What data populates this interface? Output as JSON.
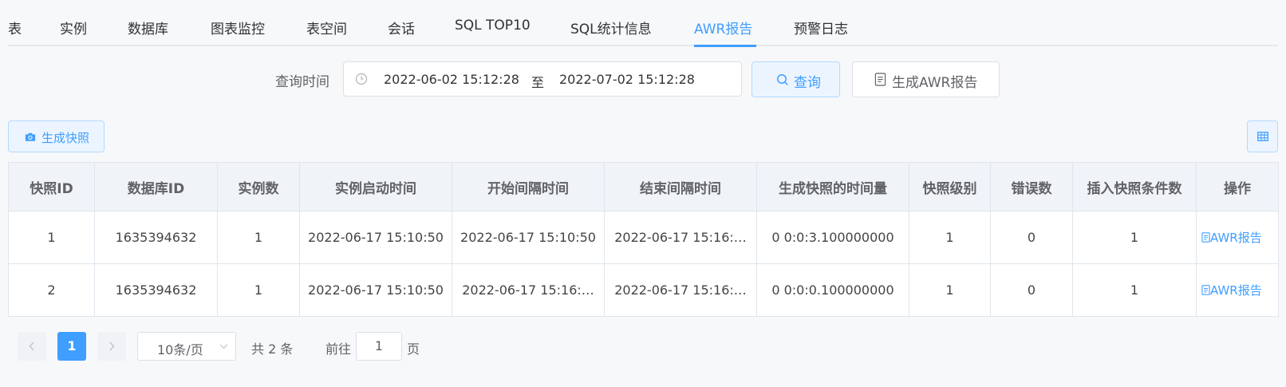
{
  "tabs": [
    {
      "label": "表"
    },
    {
      "label": "实例"
    },
    {
      "label": "数据库"
    },
    {
      "label": "图表监控"
    },
    {
      "label": "表空间"
    },
    {
      "label": "会话"
    },
    {
      "label": "SQL TOP10"
    },
    {
      "label": "SQL统计信息"
    },
    {
      "label": "AWR报告"
    },
    {
      "label": "预警日志"
    }
  ],
  "active_tab": "AWR报告",
  "search": {
    "label": "查询时间",
    "start": "2022-06-02 15:12:28",
    "separator": "至",
    "end": "2022-07-02 15:12:28",
    "query_button": "查询",
    "awr_button": "生成AWR报告"
  },
  "toolbar": {
    "snapshot_button": "生成快照"
  },
  "table": {
    "columns": [
      "快照ID",
      "数据库ID",
      "实例数",
      "实例启动时间",
      "开始间隔时间",
      "结束间隔时间",
      "生成快照的时间量",
      "快照级别",
      "错误数",
      "插入快照条件数",
      "操作"
    ],
    "rows": [
      [
        "1",
        "1635394632",
        "1",
        "2022-06-17 15:10:50",
        "2022-06-17 15:10:50",
        "2022-06-17 15:16:…",
        "0 0:0:3.100000000",
        "1",
        "0",
        "1",
        "AWR报告"
      ],
      [
        "2",
        "1635394632",
        "1",
        "2022-06-17 15:10:50",
        "2022-06-17 15:16:…",
        "2022-06-17 15:16:…",
        "0 0:0:0.100000000",
        "1",
        "0",
        "1",
        "AWR报告"
      ]
    ]
  },
  "pagination": {
    "current_page": "1",
    "page_size": "10条/页",
    "total": "共 2 条",
    "goto_label": "前往",
    "goto_value": "1",
    "page_suffix": "页"
  },
  "colors": {
    "accent": "#409eff",
    "accent_bg": "#ecf5ff",
    "header_bg": "#f0f3f8",
    "border": "#dfe6ec"
  }
}
